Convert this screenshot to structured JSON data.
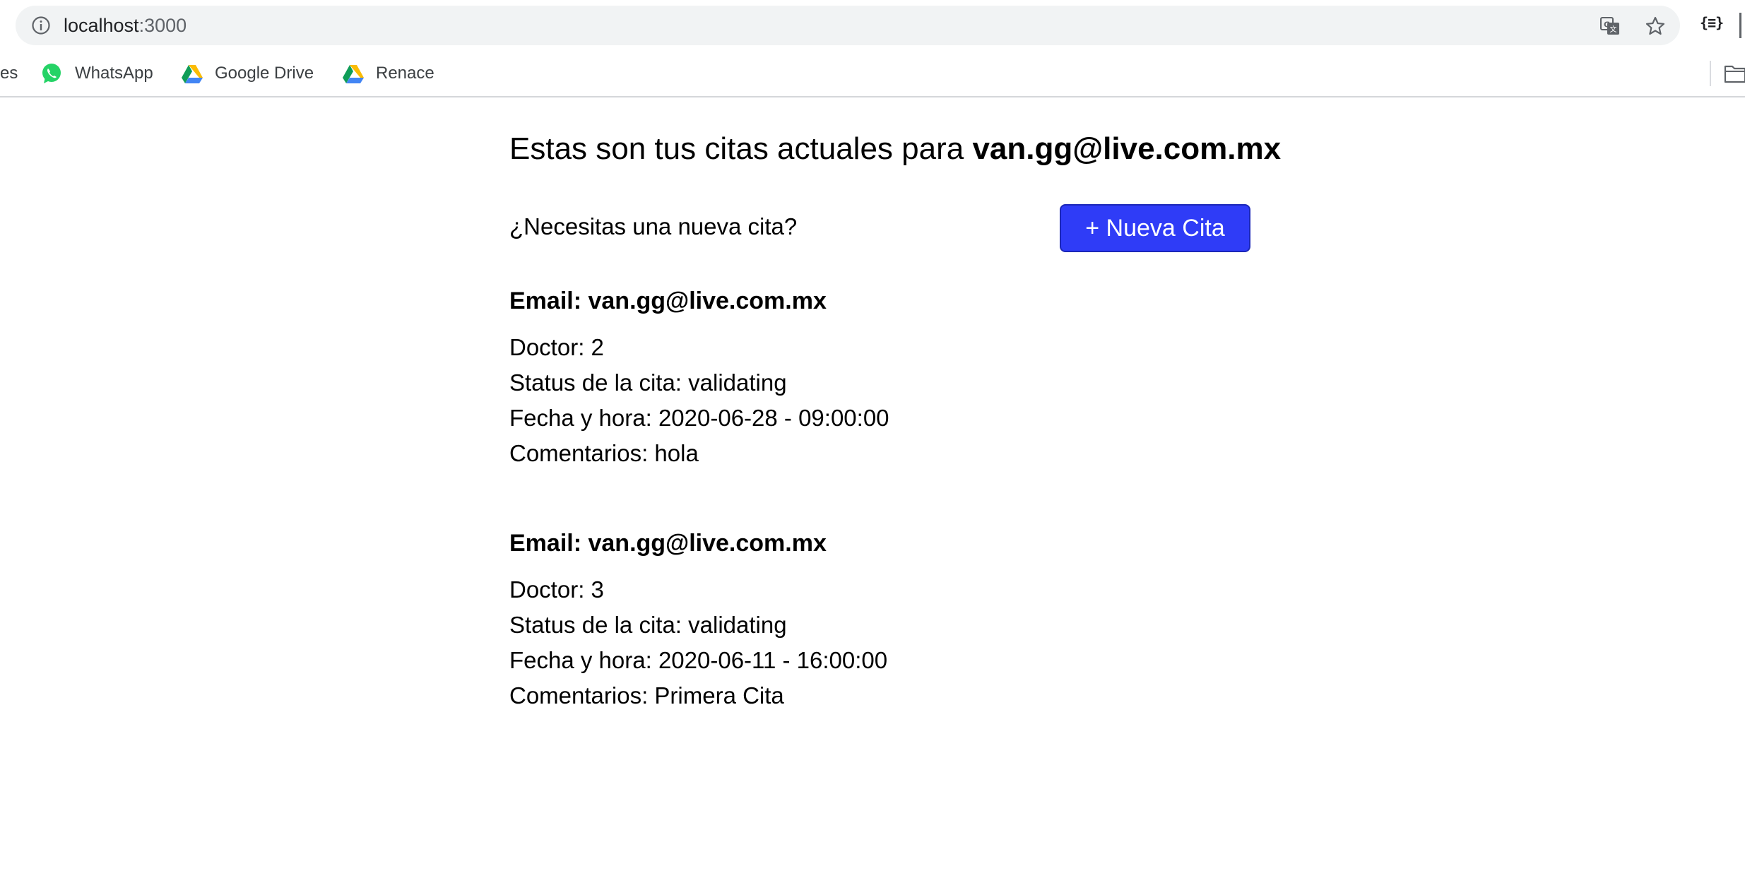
{
  "browser": {
    "url_host": "localhost",
    "url_port": ":3000",
    "bookmarks": [
      {
        "label": "es"
      },
      {
        "label": "WhatsApp"
      },
      {
        "label": "Google Drive"
      },
      {
        "label": "Renace"
      }
    ],
    "extension_label": "{≡}"
  },
  "page": {
    "heading_prefix": "Estas son tus citas actuales para ",
    "heading_email": "van.gg@live.com.mx",
    "new_prompt": "¿Necesitas una nueva cita?",
    "new_button_label": "+ Nueva Cita",
    "accent_color": "#2f3cf7"
  },
  "appointments": [
    {
      "email": "Email: van.gg@live.com.mx",
      "doctor": "Doctor: 2",
      "status": "Status de la cita: validating",
      "datetime": "Fecha y hora: 2020-06-28 - 09:00:00",
      "comments": "Comentarios: hola"
    },
    {
      "email": "Email: van.gg@live.com.mx",
      "doctor": "Doctor: 3",
      "status": "Status de la cita: validating",
      "datetime": "Fecha y hora: 2020-06-11 - 16:00:00",
      "comments": "Comentarios: Primera Cita"
    }
  ]
}
